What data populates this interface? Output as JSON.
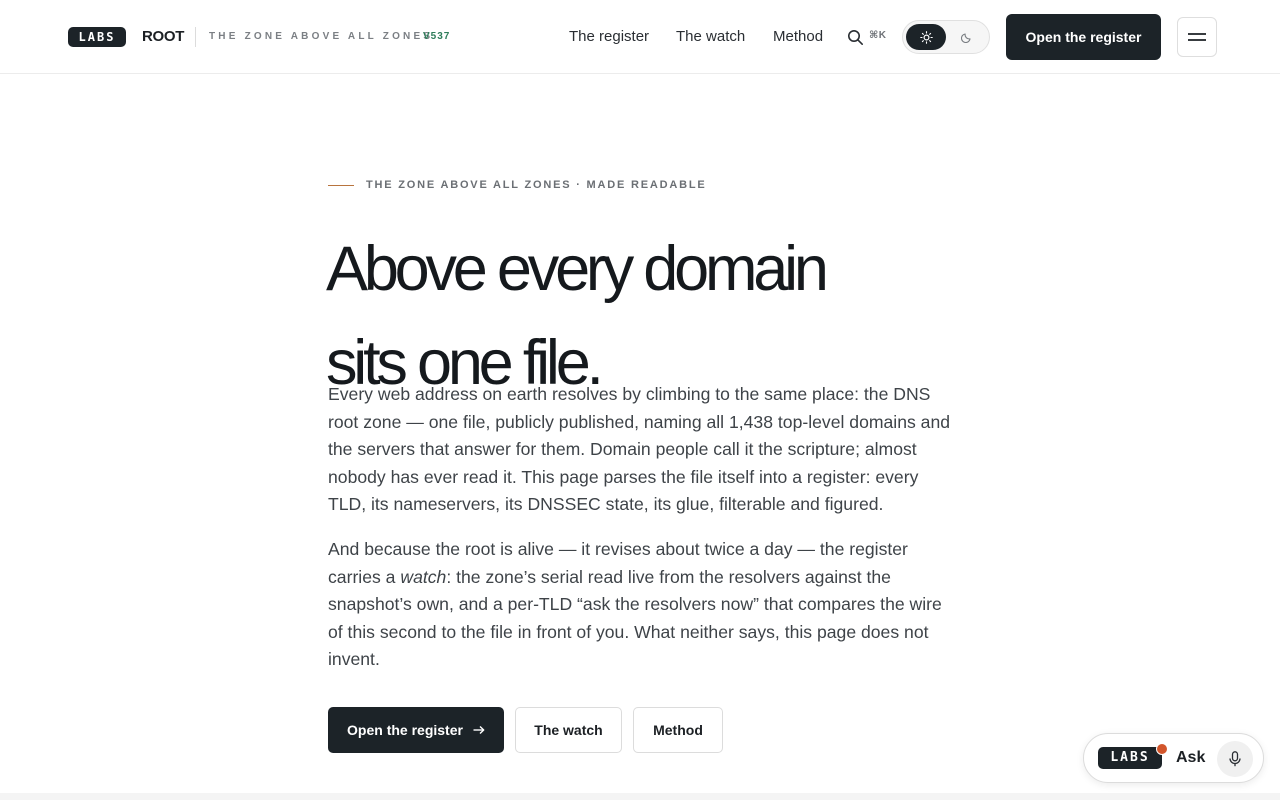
{
  "header": {
    "logo_text": "LABS",
    "brand": "ROOT",
    "tagline": "THE ZONE ABOVE ALL ZONES",
    "version": "V537",
    "nav": [
      {
        "label": "The register"
      },
      {
        "label": "The watch"
      },
      {
        "label": "Method"
      }
    ],
    "search_icon": "search-icon",
    "search_shortcut": "⌘K",
    "theme_toggle": {
      "options": [
        "sun-icon",
        "moon-icon"
      ],
      "selected": "light"
    },
    "cta_label": "Open the register",
    "menu_icon": "hamburger-icon"
  },
  "hero": {
    "eyebrow": "THE ZONE ABOVE ALL ZONES · MADE READABLE",
    "headline_line1": "Above every domain",
    "headline_line2": "sits one file.",
    "paragraph1": "Every web address on earth resolves by climbing to the same place: the DNS root zone — one file, publicly published, naming all 1,438 top-level domains and the servers that answer for them. Domain people call it the scripture; almost nobody has ever read it. This page parses the file itself into a register: every TLD, its nameservers, its DNSSEC state, its glue, filterable and figured.",
    "paragraph2_before": "And because the root is alive — it revises about twice a day — the register carries a ",
    "paragraph2_em": "watch",
    "paragraph2_after": ": the zone’s serial read live from the resolvers against the snapshot’s own, and a per-TLD “ask the resolvers now” that compares the wire of this second to the file in front of you. What neither says, this page does not invent.",
    "buttons": {
      "primary": "Open the register",
      "primary_icon": "arrow-right-icon",
      "watch": "The watch",
      "method": "Method"
    }
  },
  "ask_widget": {
    "logo_text": "LABS",
    "label": "Ask",
    "notification_color": "#d2552b",
    "mic_icon": "microphone-icon"
  },
  "colors": {
    "ink": "#1c2328",
    "accent_version": "#2e7d5a",
    "eyebrow_rule": "#b8743e"
  }
}
